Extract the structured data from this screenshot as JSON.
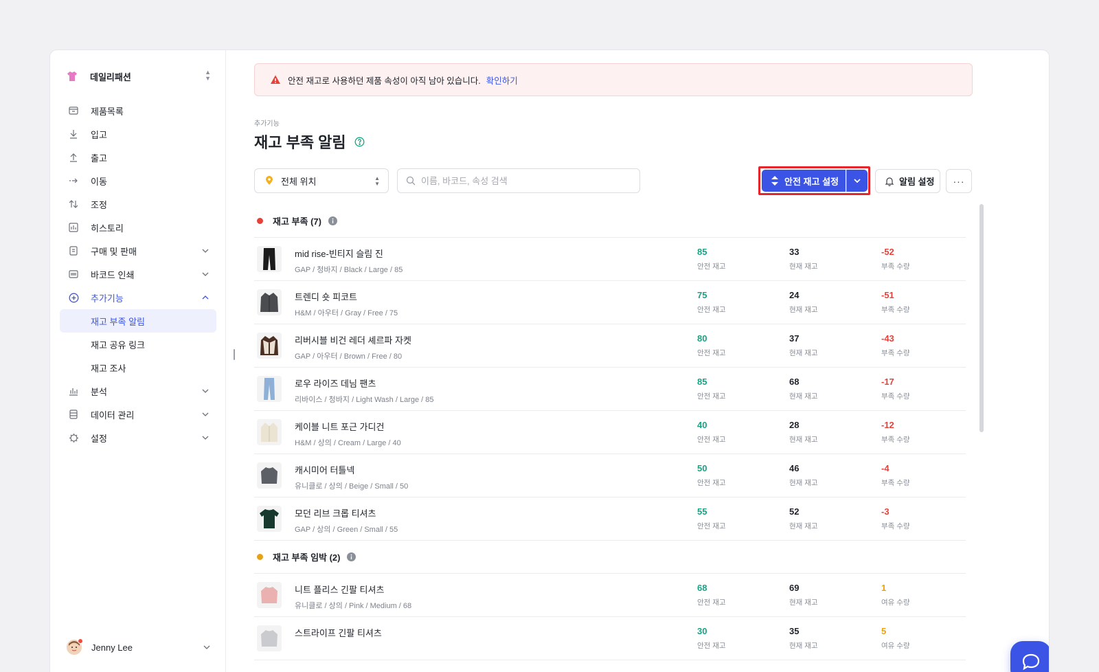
{
  "sidebar": {
    "brand": "데일리패션",
    "nav": [
      {
        "label": "제품목록",
        "icon": "box-icon"
      },
      {
        "label": "입고",
        "icon": "arrow-down-icon"
      },
      {
        "label": "출고",
        "icon": "arrow-up-icon"
      },
      {
        "label": "이동",
        "icon": "arrow-right-icon"
      },
      {
        "label": "조정",
        "icon": "swap-vertical-icon"
      },
      {
        "label": "히스토리",
        "icon": "history-icon"
      },
      {
        "label": "구매 및 판매",
        "icon": "document-icon"
      },
      {
        "label": "바코드 인쇄",
        "icon": "barcode-icon"
      },
      {
        "label": "추가기능",
        "icon": "plus-circle-icon"
      },
      {
        "label": "분석",
        "icon": "bar-chart-icon"
      },
      {
        "label": "데이터 관리",
        "icon": "database-icon"
      },
      {
        "label": "설정",
        "icon": "gear-icon"
      }
    ],
    "sub_items": [
      {
        "label": "재고 부족 알림",
        "active": true
      },
      {
        "label": "재고 공유 링크",
        "active": false
      },
      {
        "label": "재고 조사",
        "active": false
      }
    ],
    "user": "Jenny Lee"
  },
  "alert": {
    "message": "안전 재고로 사용하던 제품 속성이 아직 남아 있습니다.",
    "link": "확인하기"
  },
  "page": {
    "breadcrumb": "추가기능",
    "title": "재고 부족 알림"
  },
  "toolbar": {
    "location": "전체 위치",
    "search_placeholder": "이름, 바코드, 속성 검색",
    "safety_stock_button": "안전 재고 설정",
    "alert_button": "알림 설정"
  },
  "groups": [
    {
      "title": "재고 부족 (7)",
      "color": "#e5423a",
      "items": [
        {
          "name": "mid rise-빈티지 슬림 진",
          "meta": "GAP / 청바지 / Black / Large / 85",
          "safety": "85",
          "current": "33",
          "diff": "-52",
          "thumb": "pants-black"
        },
        {
          "name": "트렌디 숏 피코트",
          "meta": "H&M / 아우터 / Gray / Free / 75",
          "safety": "75",
          "current": "24",
          "diff": "-51",
          "thumb": "coat-gray"
        },
        {
          "name": "리버시블 비건 레더 셰르파 자켓",
          "meta": "GAP / 아우터 / Brown / Free / 80",
          "safety": "80",
          "current": "37",
          "diff": "-43",
          "thumb": "jacket-brown"
        },
        {
          "name": "로우 라이즈 데님 팬츠",
          "meta": "리바이스 / 청바지 / Light Wash / Large / 85",
          "safety": "85",
          "current": "68",
          "diff": "-17",
          "thumb": "jeans-light"
        },
        {
          "name": "케이블 니트 포근 가디건",
          "meta": "H&M / 상의 / Cream / Large / 40",
          "safety": "40",
          "current": "28",
          "diff": "-12",
          "thumb": "cardigan-cream"
        },
        {
          "name": "캐시미어 터틀넥",
          "meta": "유니클로 / 상의 / Beige / Small / 50",
          "safety": "50",
          "current": "46",
          "diff": "-4",
          "thumb": "sweater-gray"
        },
        {
          "name": "모던 리브 크롭 티셔츠",
          "meta": "GAP / 상의 / Green / Small / 55",
          "safety": "55",
          "current": "52",
          "diff": "-3",
          "thumb": "tee-green"
        }
      ]
    },
    {
      "title": "재고 부족 임박 (2)",
      "color": "#e6a116",
      "items": [
        {
          "name": "니트 플리스 긴팔 티셔츠",
          "meta": "유니클로 / 상의 / Pink / Medium / 68",
          "safety": "68",
          "current": "69",
          "diff": "1",
          "thumb": "sweater-pink"
        },
        {
          "name": "스트라이프 긴팔 티셔츠",
          "meta": "",
          "safety": "30",
          "current": "35",
          "diff": "5",
          "thumb": "tee-gray"
        }
      ]
    }
  ],
  "labels": {
    "safety": "안전 재고",
    "current": "현재 재고",
    "shortage": "부족 수량",
    "surplus": "여유 수량"
  }
}
